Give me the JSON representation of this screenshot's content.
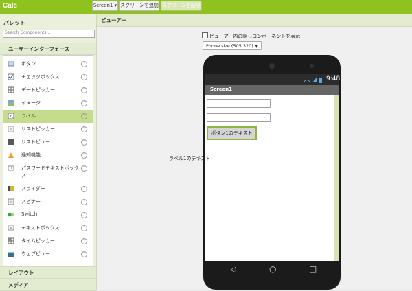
{
  "app": {
    "title": "Calc"
  },
  "toolbar": {
    "screen_select": "Screen1 ▾",
    "add_screen": "スクリーンを追加",
    "remove_screen": "スクリーンを削除"
  },
  "palette": {
    "title": "パレット",
    "search_placeholder": "Search Components...",
    "category_ui": "ユーザーインターフェース",
    "items": [
      {
        "label": "ボタン",
        "icon": "button-icon"
      },
      {
        "label": "チェックボックス",
        "icon": "checkbox-icon"
      },
      {
        "label": "デートピッカー",
        "icon": "calendar-icon"
      },
      {
        "label": "イメージ",
        "icon": "image-icon"
      },
      {
        "label": "ラベル",
        "icon": "label-icon"
      },
      {
        "label": "リストピッカー",
        "icon": "list-picker-icon"
      },
      {
        "label": "リストビュー",
        "icon": "list-view-icon"
      },
      {
        "label": "通知機能",
        "icon": "warning-icon"
      },
      {
        "label": "パスワードテキストボック",
        "label2": "ス",
        "icon": "password-icon"
      },
      {
        "label": "スライダー",
        "icon": "slider-icon"
      },
      {
        "label": "スピナー",
        "icon": "spinner-icon"
      },
      {
        "label": "Switch",
        "icon": "switch-icon"
      },
      {
        "label": "テキストボックス",
        "icon": "textbox-icon"
      },
      {
        "label": "タイムピッカー",
        "icon": "clock-icon"
      },
      {
        "label": "ウェブビュー",
        "icon": "globe-icon"
      }
    ],
    "help_glyph": "?",
    "category_layout": "レイアウト",
    "category_media": "メディア"
  },
  "viewer": {
    "title": "ビューアー",
    "hidden_checkbox_label": "ビューアー内の隠しコンポーネントを表示",
    "phone_size": "Phone size (505,320)"
  },
  "phone": {
    "time": "9:48",
    "screen_title": "Screen1",
    "button_text": "ボタン1のテキスト",
    "label_text": "ラベル1のテキスト",
    "nav_back": "◁",
    "nav_home": "○",
    "nav_recent": "□"
  },
  "colors": {
    "accent": "#8fc21e",
    "selected": "#c5dc8e"
  }
}
